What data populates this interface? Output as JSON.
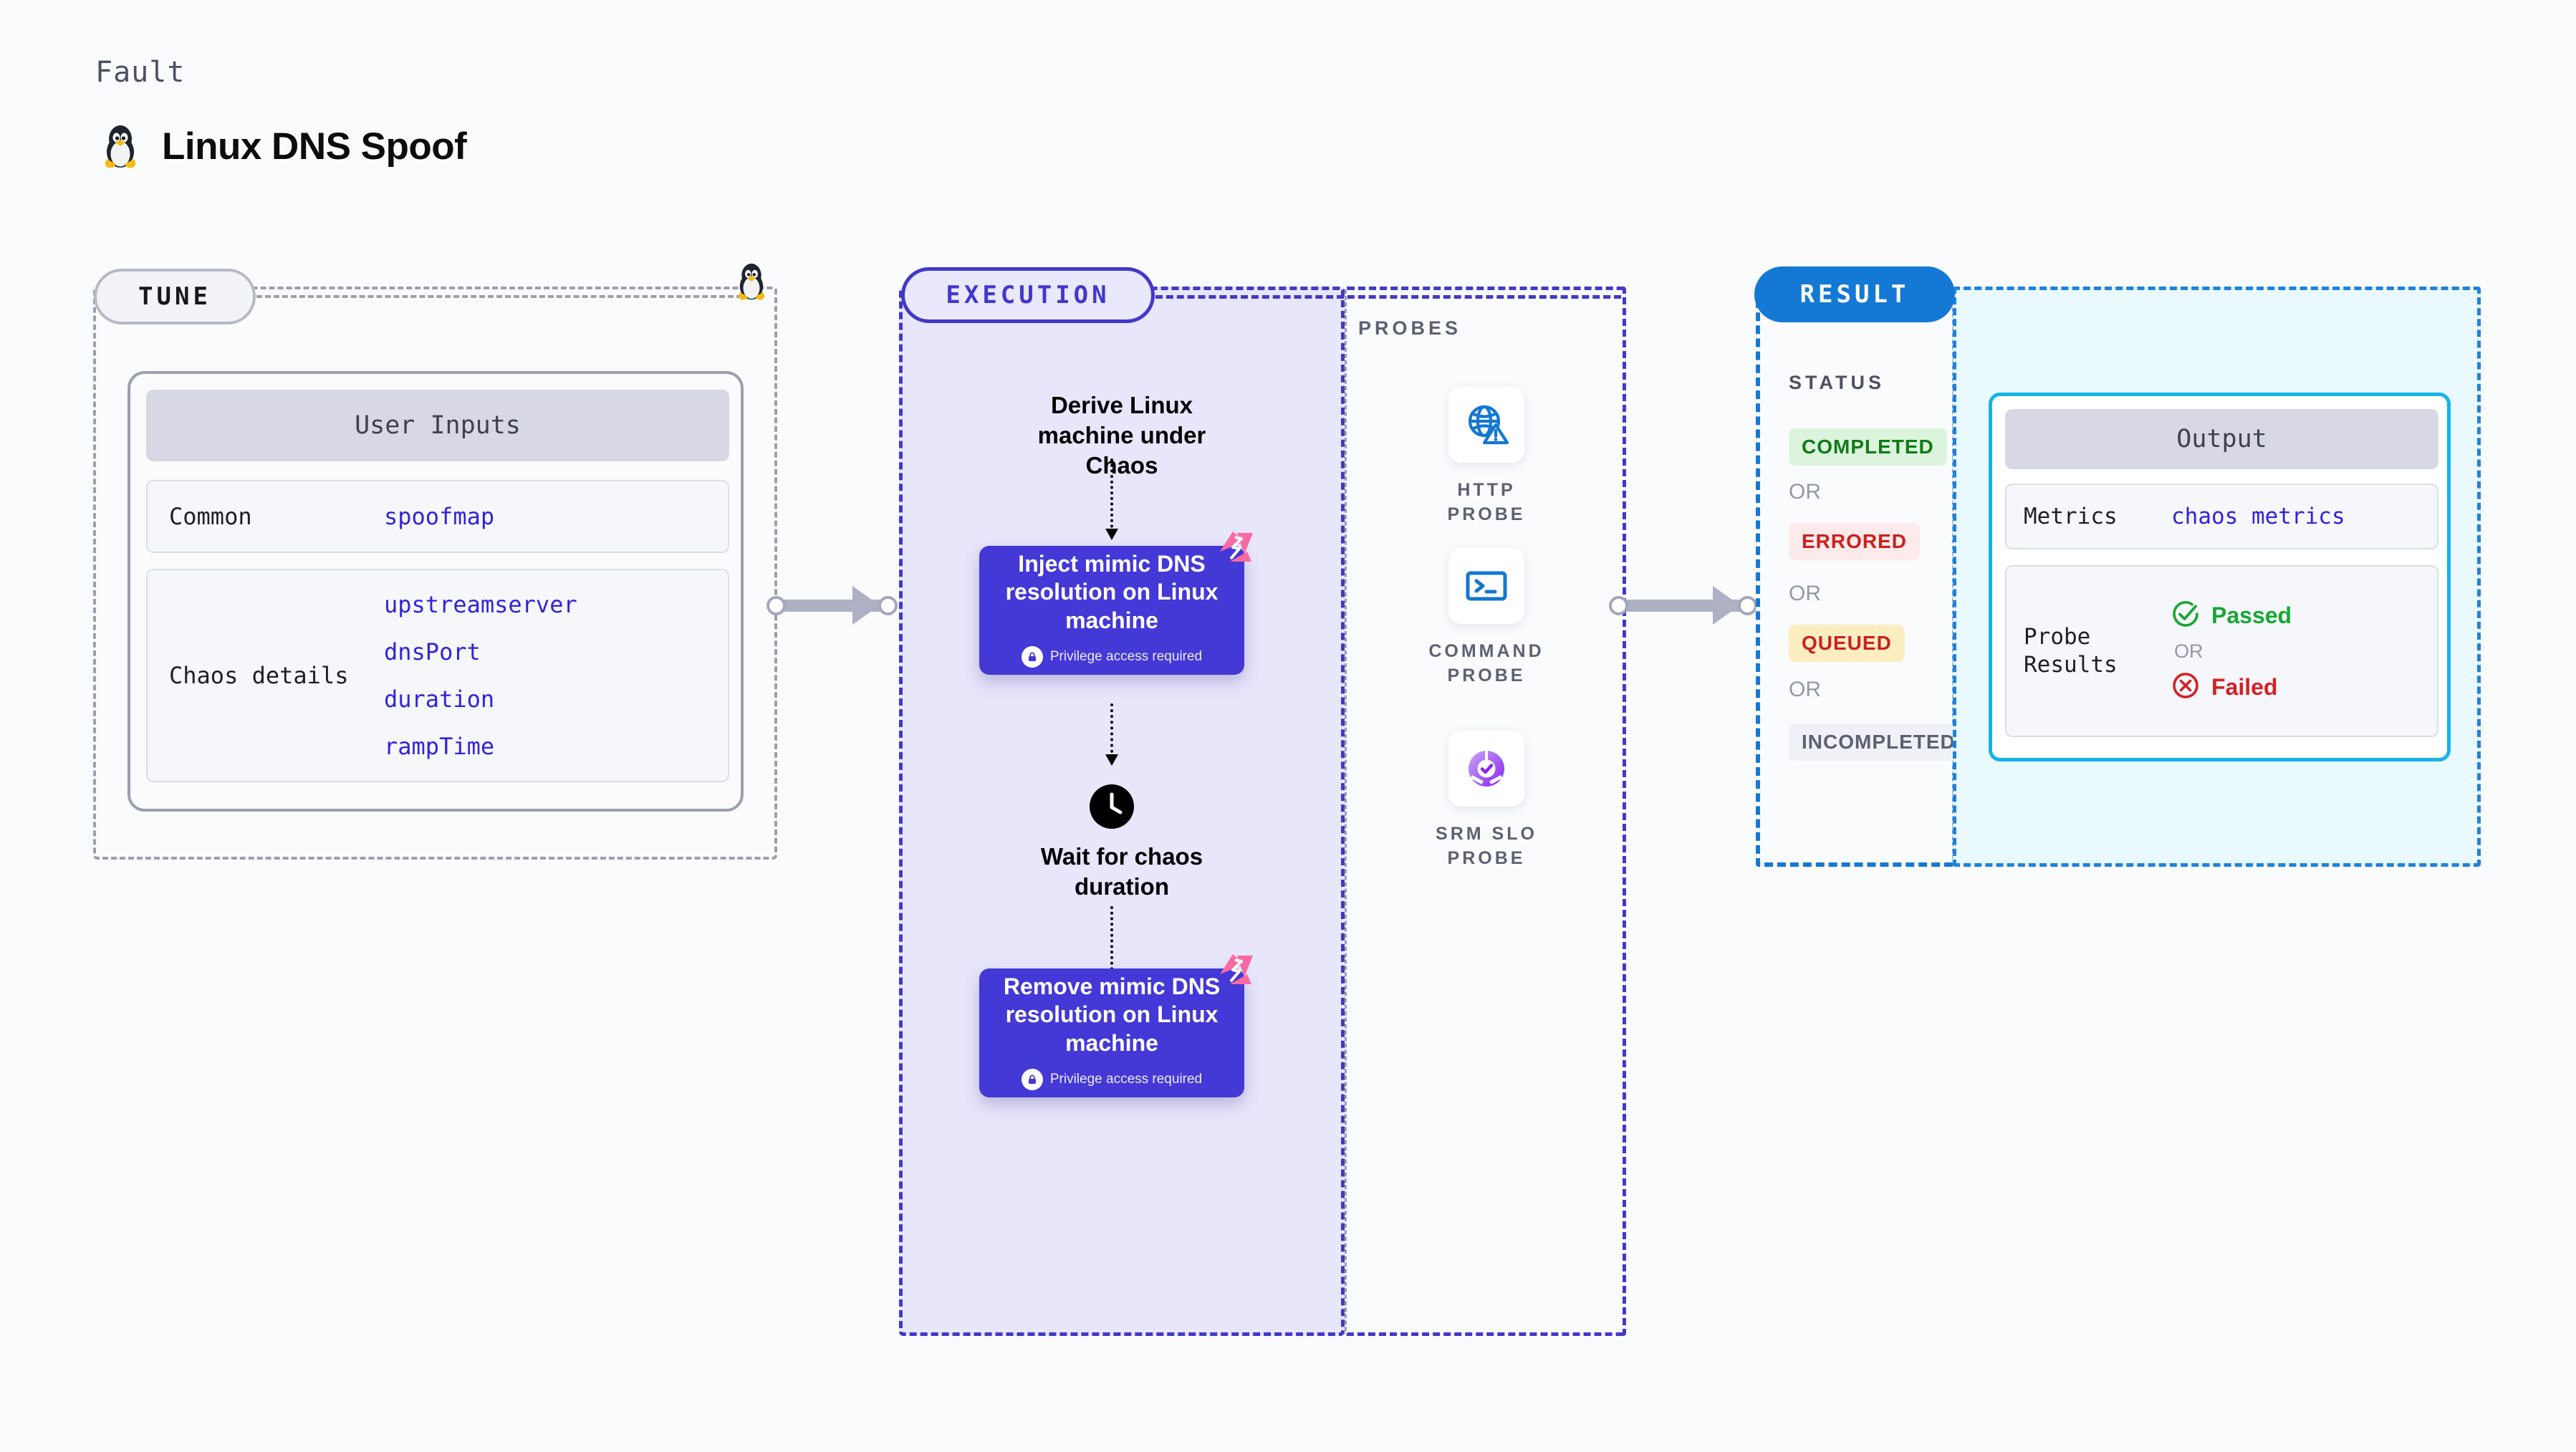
{
  "header": {
    "kicker": "Fault",
    "title": "Linux DNS Spoof",
    "icon": "linux-penguin-icon"
  },
  "tune": {
    "badge": "TUNE",
    "card_title": "User Inputs",
    "rows": [
      {
        "label": "Common",
        "values": [
          "spoofmap"
        ]
      },
      {
        "label": "Chaos details",
        "values": [
          "upstreamserver",
          "dnsPort",
          "duration",
          "rampTime"
        ]
      }
    ]
  },
  "execution": {
    "badge": "EXECUTION",
    "derive_label": "Derive Linux machine under Chaos",
    "inject_box": {
      "title": "Inject mimic DNS resolution on Linux machine",
      "note": "Privilege access required"
    },
    "wait_label": "Wait for chaos duration",
    "remove_box": {
      "title": "Remove mimic DNS resolution on Linux machine",
      "note": "Privilege access required"
    }
  },
  "probes": {
    "title": "PROBES",
    "items": [
      {
        "icon": "globe-warning-icon",
        "label": "HTTP PROBE"
      },
      {
        "icon": "terminal-prompt-icon",
        "label": "COMMAND PROBE"
      },
      {
        "icon": "slo-check-donut-icon",
        "label": "SRM SLO PROBE"
      }
    ]
  },
  "result": {
    "badge": "RESULT",
    "status_title": "STATUS",
    "or": "OR",
    "chips": [
      {
        "label": "COMPLETED",
        "bg": "#dcf4dd",
        "fg": "#107a16"
      },
      {
        "label": "ERRORED",
        "bg": "#fdeaea",
        "fg": "#cc2020"
      },
      {
        "label": "QUEUED",
        "bg": "#fdeec2",
        "fg": "#cc2020"
      },
      {
        "label": "INCOMPLETED",
        "bg": "#f0f1f6",
        "fg": "#5c6172"
      }
    ]
  },
  "output": {
    "card_title": "Output",
    "metrics_label": "Metrics",
    "metrics_value": "chaos metrics",
    "probe_results_label": "Probe Results",
    "passed": "Passed",
    "failed": "Failed",
    "or": "OR"
  },
  "colors": {
    "execution_accent": "#4338ca",
    "result_accent": "#1379d4",
    "output_accent": "#15b3e8",
    "tune_accent": "#9ba0ae",
    "action_box": "#4438d6",
    "value_text": "#3322dd",
    "pass_green": "#16a834",
    "fail_red": "#d61f26"
  }
}
